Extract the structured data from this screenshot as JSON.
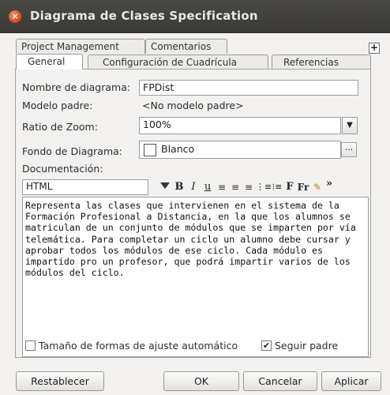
{
  "window": {
    "title": "Diagrama de Clases Specification"
  },
  "tabs": {
    "row_top": [
      "Project Management",
      "Comentarios"
    ],
    "row_bottom": [
      "General",
      "Configuración de Cuadrícula",
      "Referencias"
    ],
    "active": "General"
  },
  "form": {
    "nombre_label": "Nombre de diagrama:",
    "nombre_value": "FPDist",
    "modelo_label": "Modelo padre:",
    "modelo_value": "<No modelo padre>",
    "zoom_label": "Ratio de Zoom:",
    "zoom_value": "100%",
    "fondo_label": "Fondo de Diagrama:",
    "fondo_value": "Blanco",
    "fondo_button": "...",
    "doc_label": "Documentación:"
  },
  "editor": {
    "format": "HTML",
    "toolbar": [
      "B",
      "I",
      "u",
      "≡",
      "≡",
      "≡",
      "⋮≡",
      "⁝≡",
      "F",
      "Fr",
      "✎",
      "»"
    ],
    "text": "Representa las clases que intervienen en el sistema de la Formación Profesional a Distancia, en la que los alumnos se matriculan de un conjunto de módulos que se imparten por vía telemática. Para completar un ciclo un alumno debe cursar y aprobar todos los módulos de ese ciclo. Cada módulo es impartido pro un profesor, que podrá impartir varios de los módulos del ciclo."
  },
  "options": {
    "auto_resize_label": "Tamaño de formas de ajuste automático",
    "auto_resize_checked": false,
    "follow_parent_label": "Seguir padre",
    "follow_parent_checked": true
  },
  "buttons": {
    "reset": "Restablecer",
    "ok": "OK",
    "cancel": "Cancelar",
    "apply": "Aplicar"
  }
}
